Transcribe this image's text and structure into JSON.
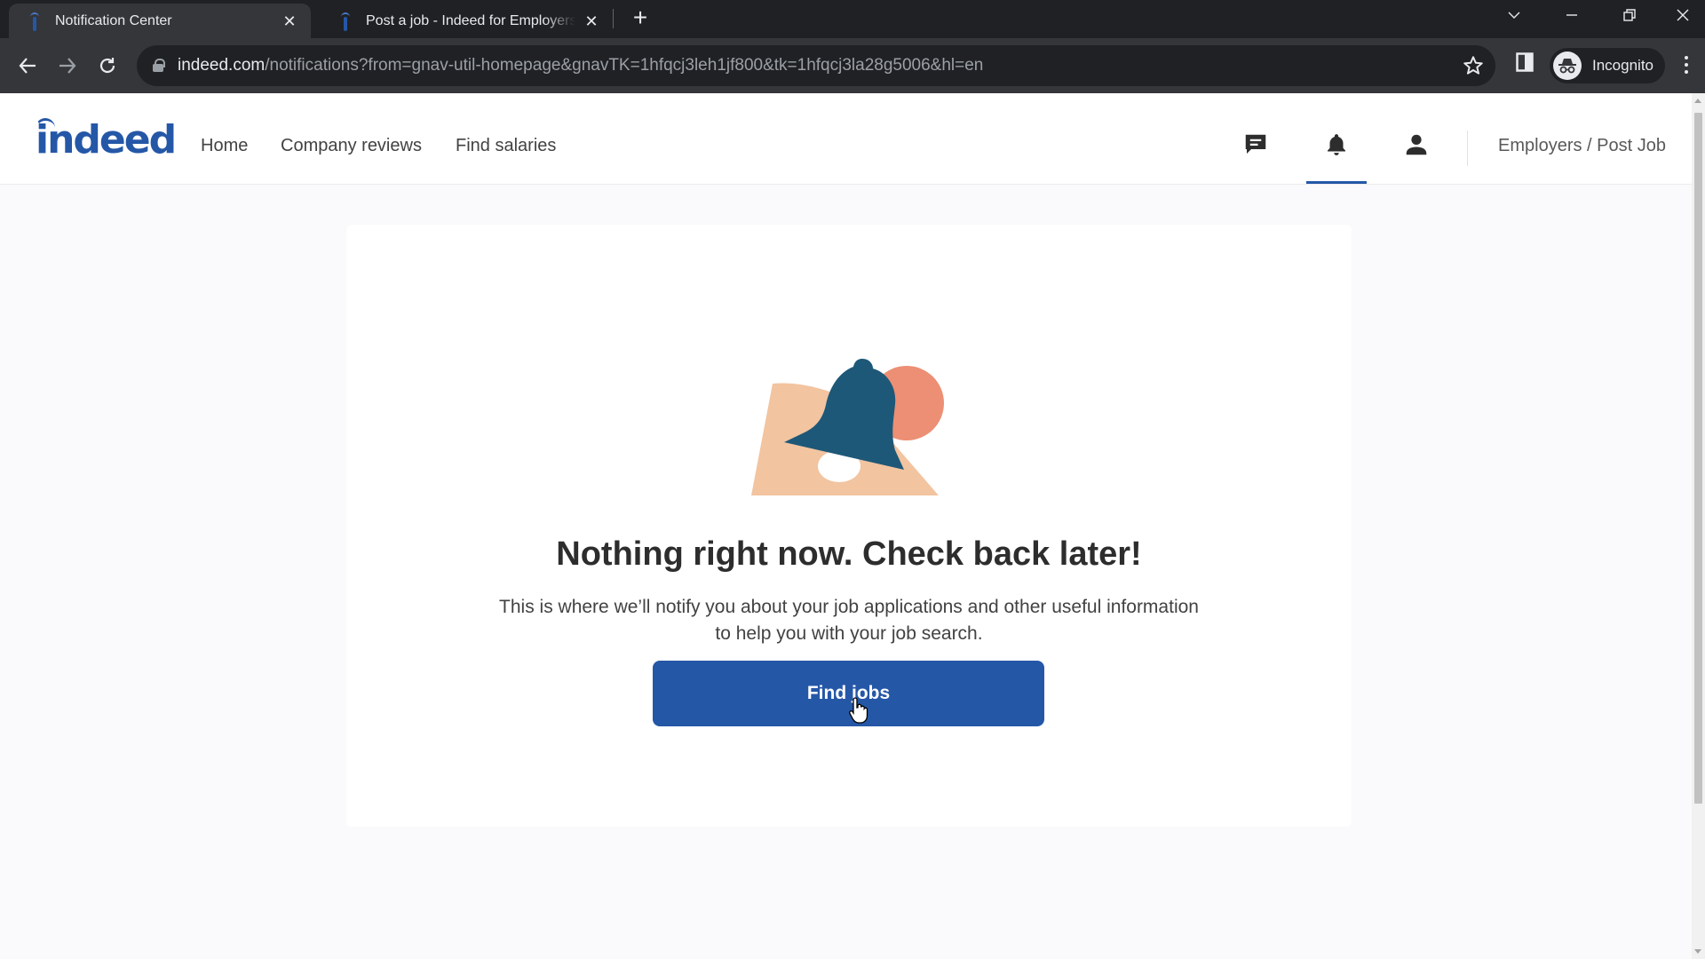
{
  "browser": {
    "tabs": [
      {
        "title": "Notification Center",
        "active": true,
        "favicon": "indeed-favicon"
      },
      {
        "title": "Post a job - Indeed for Employers",
        "active": false,
        "favicon": "indeed-favicon"
      }
    ],
    "new_tab_label": "+",
    "close_glyph": "✕",
    "url": {
      "host": "indeed.com",
      "path": "/notifications?from=gnav-util-homepage&gnavTK=1hfqcj3leh1jf800&tk=1hfqcj3la28g5006&hl=en"
    },
    "profile_label": "Incognito",
    "icons": [
      "back-icon",
      "forward-icon",
      "reload-icon",
      "lock-icon",
      "bookmark-star-icon",
      "side-panel-icon",
      "incognito-icon",
      "menu-icon",
      "tab-search-icon",
      "minimize-icon",
      "restore-icon",
      "close-window-icon"
    ]
  },
  "site": {
    "logo_text": "indeed",
    "brand_color": "#2557a7",
    "nav": [
      {
        "label": "Home"
      },
      {
        "label": "Company reviews"
      },
      {
        "label": "Find salaries"
      }
    ],
    "header_icons": [
      {
        "name": "messages-icon",
        "active": false
      },
      {
        "name": "notifications-bell-icon",
        "active": true
      },
      {
        "name": "profile-icon",
        "active": false
      }
    ],
    "employers_link": "Employers / Post Job"
  },
  "empty_state": {
    "illustration": "bell-illustration",
    "title": "Nothing right now. Check back later!",
    "description": "This is where we’ll notify you about your job applications and other useful information to help you with your job search.",
    "cta_label": "Find jobs"
  }
}
